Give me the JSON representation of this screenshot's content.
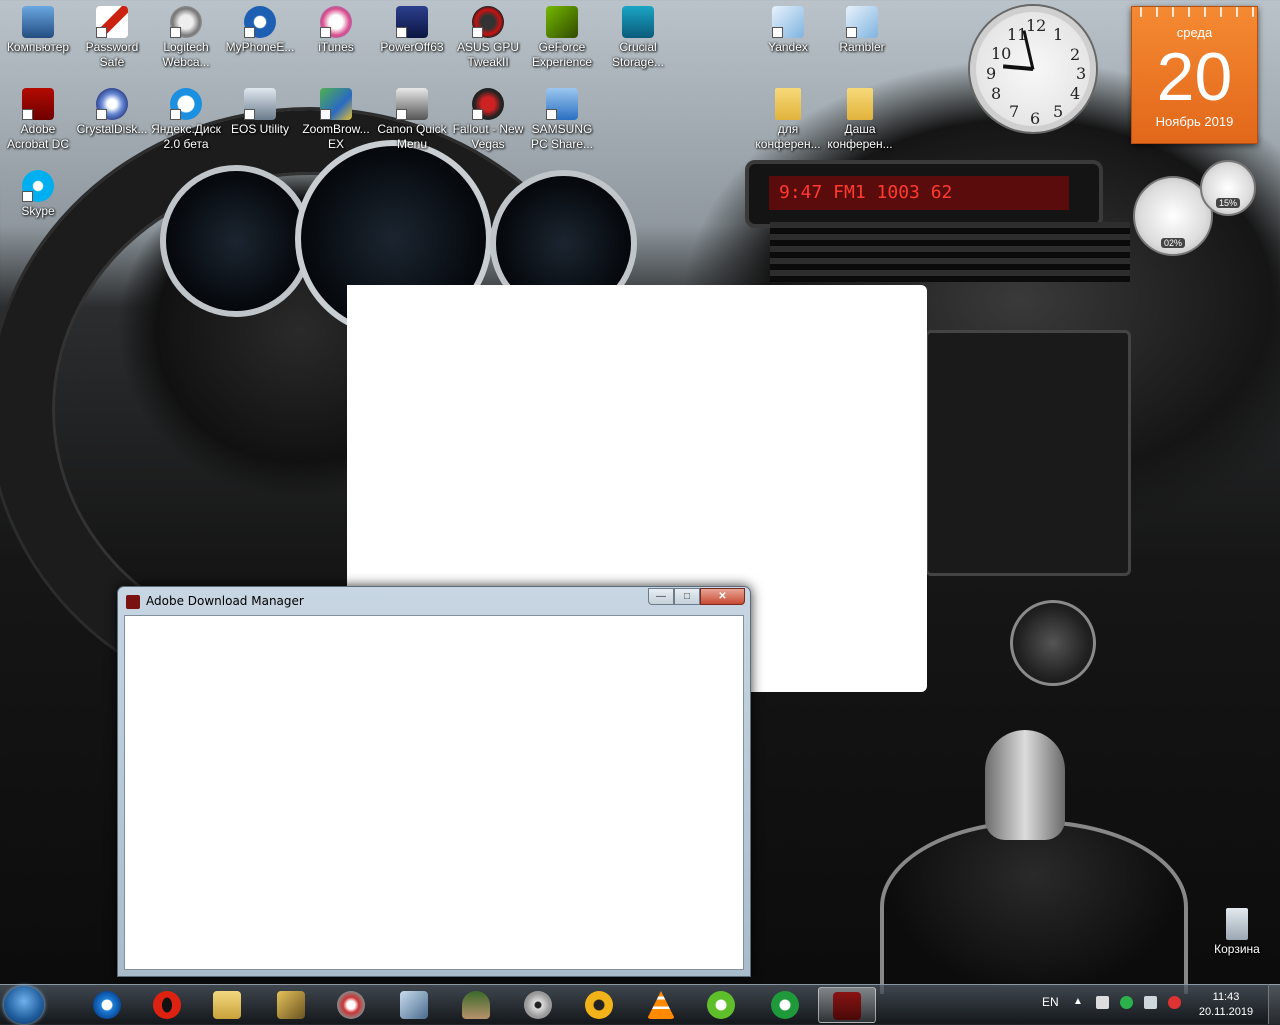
{
  "desktop_icons": [
    {
      "label": "Компьютер",
      "icon": "computer-icon"
    },
    {
      "label": "Password Safe",
      "icon": "password-safe-icon"
    },
    {
      "label": "Logitech Webca...",
      "icon": "webcam-icon"
    },
    {
      "label": "MyPhoneE...",
      "icon": "myphone-icon"
    },
    {
      "label": "iTunes",
      "icon": "itunes-icon"
    },
    {
      "label": "PowerOff63",
      "icon": "poweroff-icon"
    },
    {
      "label": "ASUS GPU TweakII",
      "icon": "asus-gpu-icon"
    },
    {
      "label": "GeForce Experience",
      "icon": "geforce-icon"
    },
    {
      "label": "Crucial Storage...",
      "icon": "crucial-icon"
    },
    {
      "label": "Yandex",
      "icon": "yandex-icon"
    },
    {
      "label": "Rambler",
      "icon": "rambler-icon"
    },
    {
      "label": "Adobe Acrobat DC",
      "icon": "acrobat-icon"
    },
    {
      "label": "CrystalDisk...",
      "icon": "crystaldisk-icon"
    },
    {
      "label": "Яндекс.Диск 2.0 бета",
      "icon": "yandex-disk-icon"
    },
    {
      "label": "EOS Utility",
      "icon": "eos-icon"
    },
    {
      "label": "ZoomBrow... EX",
      "icon": "zoombrowser-icon"
    },
    {
      "label": "Canon Quick Menu",
      "icon": "canon-icon"
    },
    {
      "label": "Fallout - New Vegas",
      "icon": "fallout-icon"
    },
    {
      "label": "SAMSUNG PC Share...",
      "icon": "samsung-icon"
    },
    {
      "label": "для конферен...",
      "icon": "folder-icon"
    },
    {
      "label": "Даша конферен...",
      "icon": "folder-icon"
    },
    {
      "label": "Skype",
      "icon": "skype-icon"
    },
    {
      "label": "Корзина",
      "icon": "recycle-bin-icon"
    }
  ],
  "calendar": {
    "weekday": "среда",
    "day": "20",
    "month_year": "Ноябрь 2019"
  },
  "cpu_meter": {
    "cpu": "02%",
    "mem": "15%"
  },
  "wallpaper_radio": {
    "display": "9:47  FM1  1003   62"
  },
  "window": {
    "title": "Adobe Download Manager",
    "min_glyph": "—",
    "max_glyph": "□",
    "close_glyph": "✕"
  },
  "taskbar": {
    "pinned": [
      "ie-icon",
      "opera-icon",
      "explorer-icon",
      "tool-icon",
      "media-icon",
      "photo-icon",
      "agent-icon",
      "disc-icon",
      "aimp-icon",
      "vlc-icon",
      "utorrent-icon",
      "p-app-icon",
      "adobe-download-icon"
    ],
    "language": "EN",
    "time": "11:43",
    "date": "20.11.2019"
  },
  "colors": {
    "accent_orange": "#e2671a",
    "window_chrome": "#a9bccb",
    "close_red": "#c74a34"
  }
}
